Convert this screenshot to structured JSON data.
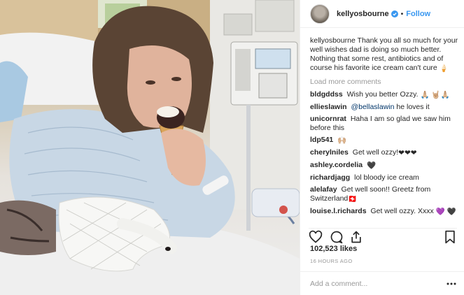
{
  "header": {
    "username": "kellyosbourne",
    "separator": "•",
    "follow_label": "Follow"
  },
  "caption": {
    "username": "kellyosbourne",
    "text": "Thank you all so much for your well wishes dad is doing so much better. Nothing that some rest, antibiotics and of course his favorite ice cream can't cure",
    "emoji": "🍦"
  },
  "load_more_label": "Load more comments",
  "comments": [
    {
      "user": "bldgddss",
      "text": "Wish you better Ozzy.",
      "emoji": "🙏🏼 🤘🏼🙏🏼"
    },
    {
      "user": "ellieslawin",
      "mention": "@bellaslawin",
      "text": "he loves it",
      "emoji": ""
    },
    {
      "user": "unicornrat",
      "text": "Haha I am so glad we saw him before this",
      "emoji": ""
    },
    {
      "user": "ldp541",
      "text": "",
      "emoji": "🙌🏼"
    },
    {
      "user": "cherylniles",
      "text": "Get well ozzy!",
      "emoji": "❤❤❤"
    },
    {
      "user": "ashley.cordelia",
      "text": "",
      "emoji": "🖤"
    },
    {
      "user": "richardjagg",
      "text": "lol bloody ice cream",
      "emoji": ""
    },
    {
      "user": "alelafay",
      "text": "Get well soon!! Greetz from Switzerland",
      "emoji": "🇨🇭"
    },
    {
      "user": "louise.l.richards",
      "text": "Get well ozzy. Xxxx",
      "emoji": "💜 🖤"
    }
  ],
  "likes_text": "102,523 likes",
  "timestamp": "16 HOURS AGO",
  "add_comment_placeholder": "Add a comment...",
  "colors": {
    "follow": "#3897f0",
    "verified": "#3897f0",
    "muted": "#999999",
    "border": "#efefef"
  },
  "icons": [
    "heart-icon",
    "comment-icon",
    "share-icon",
    "bookmark-icon",
    "more-options-icon",
    "verified-badge-icon"
  ]
}
